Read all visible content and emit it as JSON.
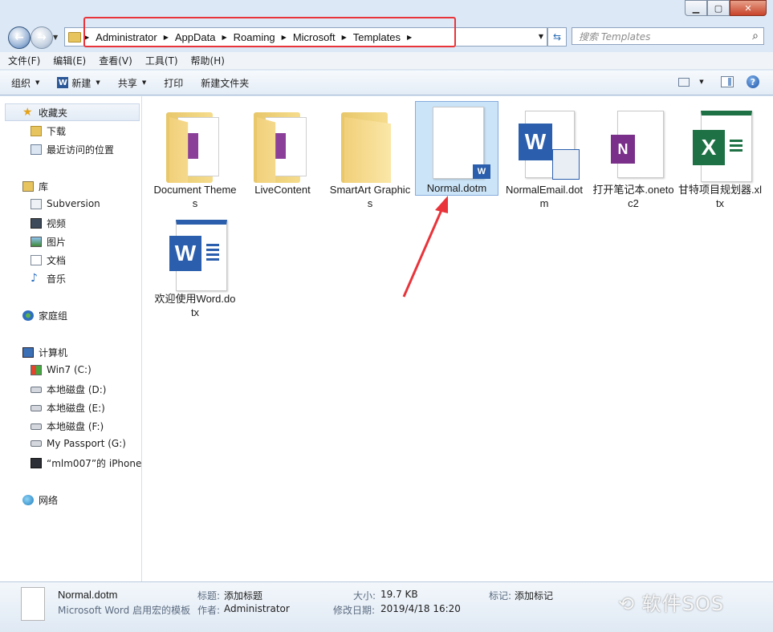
{
  "window": {
    "caption": {
      "minimize": "▁",
      "maximize": "▢",
      "close": "✕"
    }
  },
  "address": {
    "crumbs": [
      "Administrator",
      "AppData",
      "Roaming",
      "Microsoft",
      "Templates"
    ],
    "search_placeholder": "搜索 Templates"
  },
  "menu": [
    "文件(F)",
    "编辑(E)",
    "查看(V)",
    "工具(T)",
    "帮助(H)"
  ],
  "toolbar": {
    "organize": "组织",
    "new": "新建",
    "share": "共享",
    "print": "打印",
    "new_folder": "新建文件夹"
  },
  "sidebar": {
    "favorites": "收藏夹",
    "fav_items": [
      "下载",
      "最近访问的位置"
    ],
    "libraries": "库",
    "lib_items": [
      "Subversion",
      "视频",
      "图片",
      "文档",
      "音乐"
    ],
    "homegroup": "家庭组",
    "computer": "计算机",
    "drives": [
      "Win7 (C:)",
      "本地磁盘 (D:)",
      "本地磁盘 (E:)",
      "本地磁盘 (F:)",
      "My Passport (G:)",
      "“mlm007”的 iPhone"
    ],
    "network": "网络"
  },
  "files": [
    {
      "label": "Document Themes",
      "type": "folder"
    },
    {
      "label": "LiveContent",
      "type": "folder"
    },
    {
      "label": "SmartArt Graphics",
      "type": "folder"
    },
    {
      "label": "Normal.dotm",
      "type": "dotm"
    },
    {
      "label": "NormalEmail.dotm",
      "type": "word"
    },
    {
      "label": "打开笔记本.onetoc2",
      "type": "onenote"
    },
    {
      "label": "甘特项目规划器.xltx",
      "type": "excel"
    },
    {
      "label": "欢迎使用Word.dotx",
      "type": "word"
    }
  ],
  "status": {
    "name": "Normal.dotm",
    "type": "Microsoft Word 启用宏的模板",
    "title_label": "标题:",
    "title_value": "添加标题",
    "author_label": "作者:",
    "author_value": "Administrator",
    "size_label": "大小:",
    "size_value": "19.7 KB",
    "modified_label": "修改日期:",
    "modified_value": "2019/4/18 16:20",
    "tags_label": "标记:",
    "tags_value": "添加标记"
  },
  "watermark": "软件SOS",
  "colors": {
    "annotation_red": "#e8343a",
    "selection": "#cce4f7",
    "word_blue": "#2b5fad",
    "excel_green": "#1e7145",
    "onenote_purple": "#7a2f8a"
  }
}
